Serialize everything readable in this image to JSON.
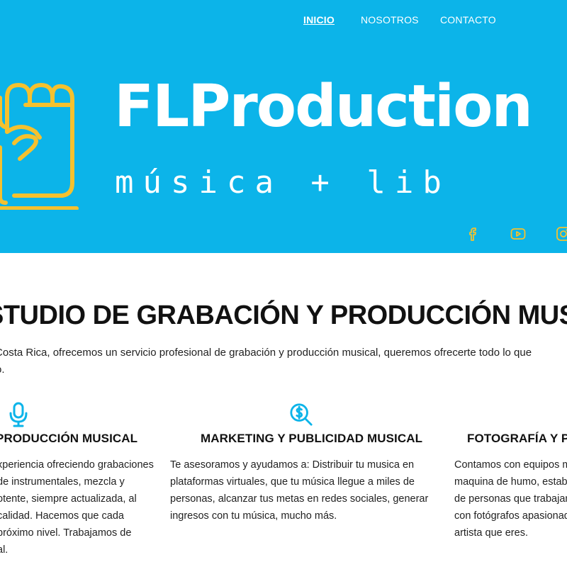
{
  "nav": {
    "items": [
      {
        "label": "INICIO",
        "active": true
      },
      {
        "label": "NOSOTROS",
        "active": false
      },
      {
        "label": "CONTACTO",
        "active": false
      }
    ]
  },
  "hero": {
    "brand": "FLProduction",
    "tagline": "música + lib",
    "logo_icon": "raised-fist-icon",
    "social_icons": [
      "facebook-icon",
      "youtube-icon",
      "instagram-icon"
    ]
  },
  "main": {
    "section_title": "STUDIO DE GRABACIÓN Y PRODUCCIÓN MUS",
    "intro_line1": "ón, Costa Rica, ofrecemos un servicio profesional de grabación y producción musical, queremos ofrecerte todo lo que",
    "intro_line2": "o."
  },
  "services": [
    {
      "icon": "microphone-icon",
      "title": "PRODUCCIÓN MUSICAL",
      "lines": [
        "xperiencia ofreciendo grabaciones",
        "de instrumentales, mezcla y",
        "otente, siempre actualizada, al",
        "calidad. Hacemos que cada",
        "próximo nivel. Trabajamos de",
        "al."
      ]
    },
    {
      "icon": "money-search-icon",
      "title": "MARKETING Y PUBLICIDAD MUSICAL",
      "lines": [
        "Te asesoramos y ayudamos a: Distribuir tu musica en",
        "plataformas virtuales, que tu música llegue a miles de",
        "personas, alcanzar tus metas en redes sociales, generar",
        "ingresos con tu música, mucho más."
      ]
    },
    {
      "icon": "",
      "title": "FOTOGRAFÍA Y PR",
      "lines": [
        "Contamos con equipos m",
        "maquina de humo, estabil",
        "de personas que trabajan",
        "con fotógrafos apasionad",
        "artista que eres."
      ]
    }
  ],
  "colors": {
    "hero_bg": "#0cb4e9",
    "accent_yellow": "#f5c12e",
    "icon_blue": "#0cb4e9",
    "text_dark": "#111111"
  }
}
